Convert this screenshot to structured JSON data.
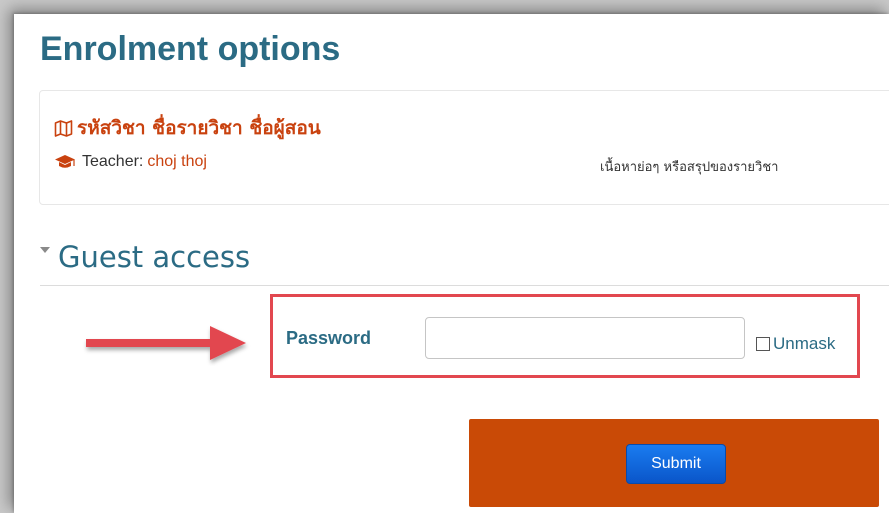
{
  "page": {
    "title": "Enrolment options"
  },
  "course": {
    "name": "รหัสวิชา ชื่อรายวิชา ชื่อผู้สอน",
    "teacher_label": "Teacher:",
    "teacher_name": "choj thoj",
    "summary": "เนื้อหาย่อๆ หรือสรุปของรายวิชา",
    "course_icon": "map-icon",
    "teacher_icon": "graduation-cap-icon"
  },
  "guest_access": {
    "title": "Guest access",
    "toggle_icon": "caret-down-icon",
    "password_label": "Password",
    "password_value": "",
    "password_placeholder": "",
    "unmask_label": "Unmask",
    "unmask_checked": false,
    "submit_label": "Submit"
  },
  "annotations": {
    "arrow_icon": "arrow-right-icon",
    "arrow_color": "#e2474f",
    "highlight_color": "#e2474f",
    "submit_panel_color": "#c94a06"
  },
  "colors": {
    "heading": "#2b6b84",
    "course_link": "#c9420f",
    "submit_button": "#1a6fe0"
  }
}
